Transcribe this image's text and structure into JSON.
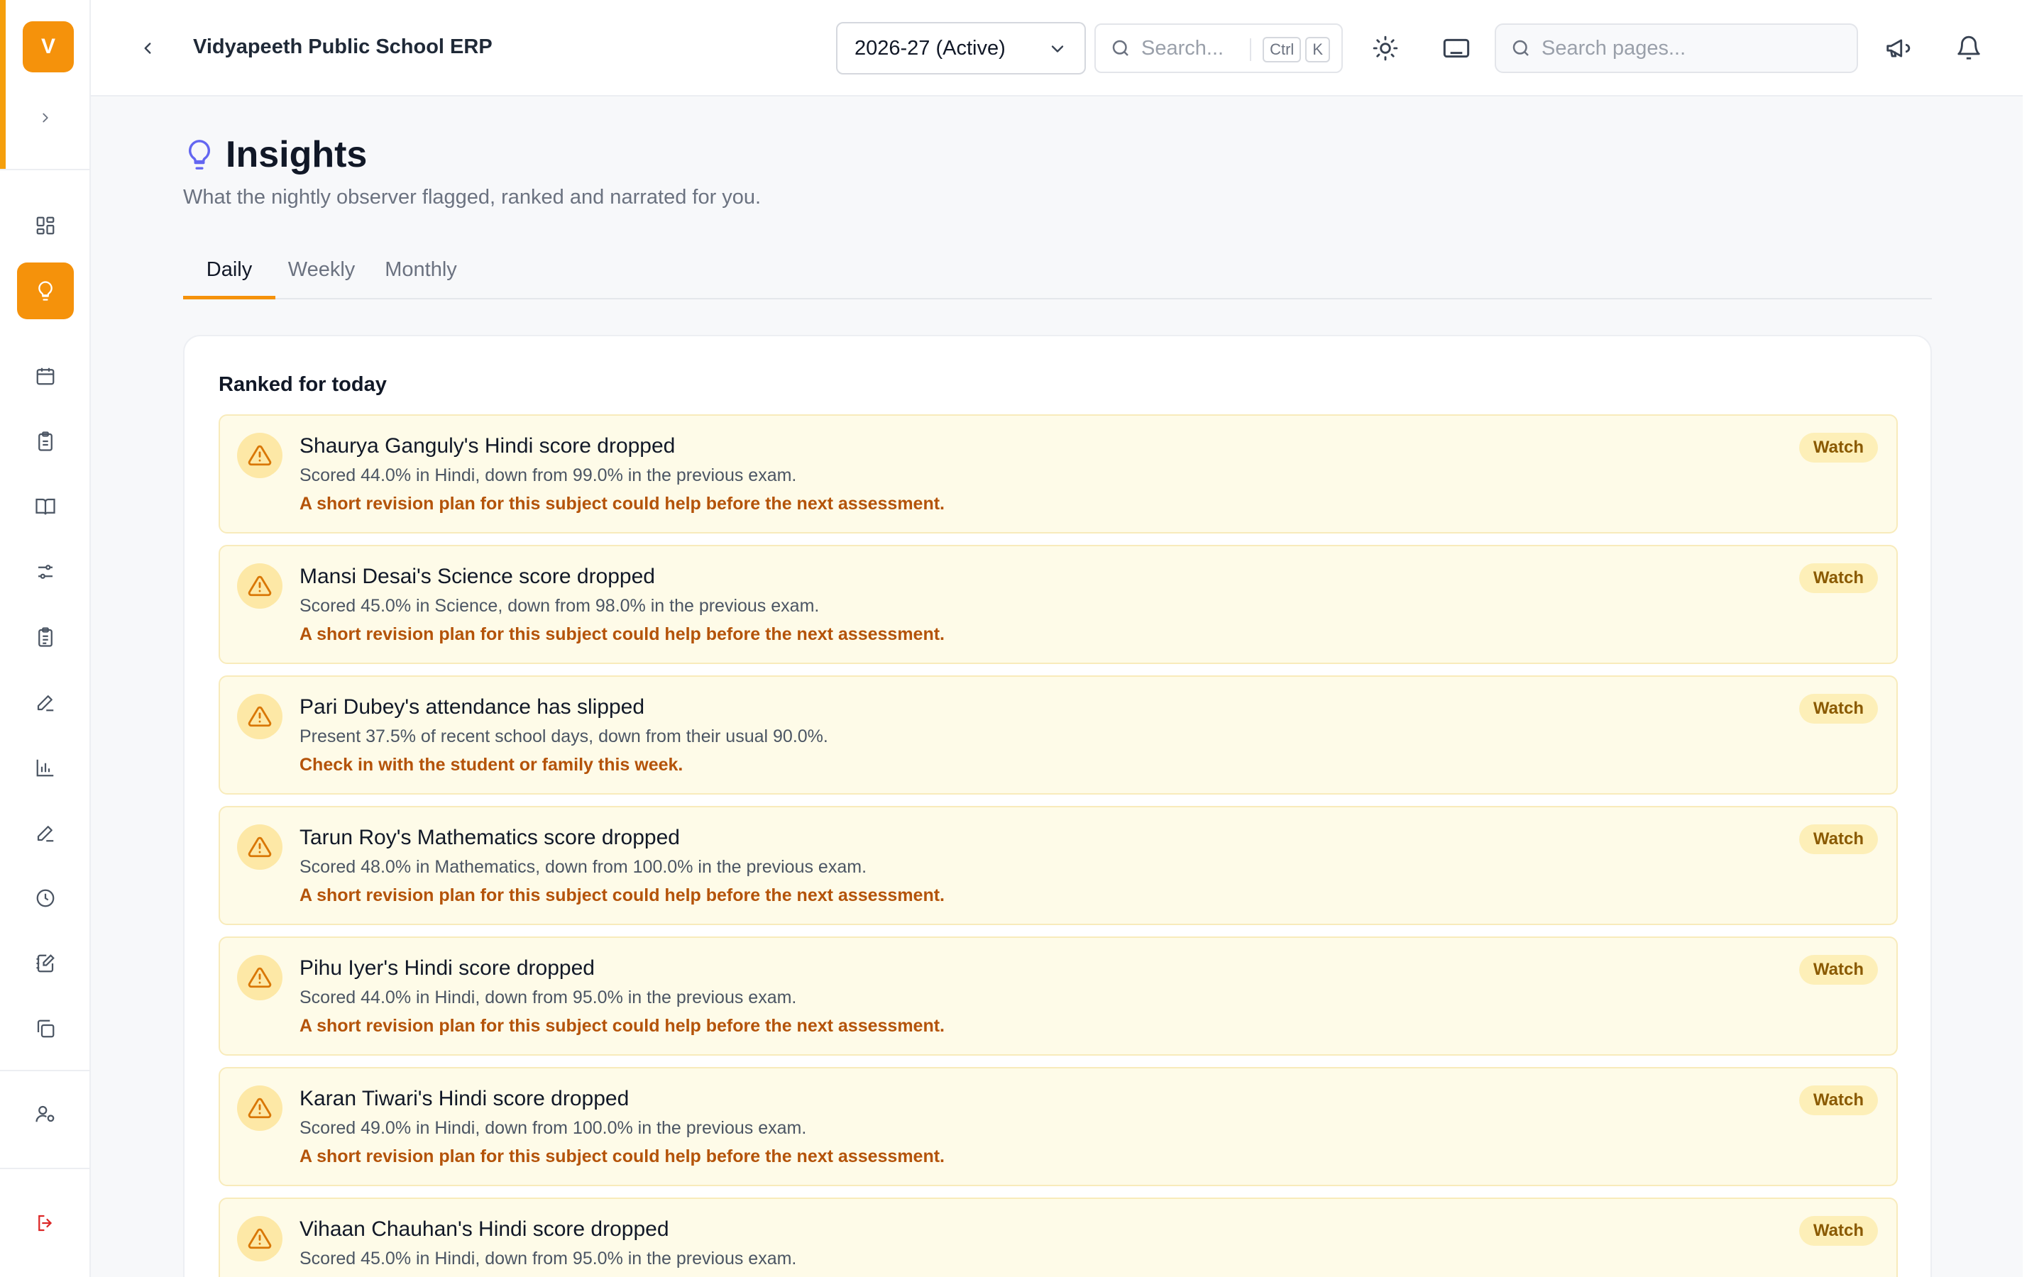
{
  "sidebar": {
    "logo_letter": "V",
    "items": [
      {
        "icon": "dashboard-icon"
      },
      {
        "icon": "lightbulb-icon",
        "active": true
      },
      {
        "icon": "calendar-icon"
      },
      {
        "icon": "clipboard-icon"
      },
      {
        "icon": "book-icon"
      },
      {
        "icon": "sliders-icon"
      },
      {
        "icon": "clipboard-list-icon"
      },
      {
        "icon": "pencil-icon"
      },
      {
        "icon": "bar-chart-icon"
      },
      {
        "icon": "edit-icon"
      },
      {
        "icon": "clock-icon"
      },
      {
        "icon": "notebook-pen-icon"
      },
      {
        "icon": "copy-icon"
      },
      {
        "icon": "user-settings-icon"
      },
      {
        "icon": "logout-icon"
      }
    ]
  },
  "header": {
    "title": "Vidyapeeth Public School ERP",
    "academic_year": "2026-27 (Active)",
    "search_placeholder": "Search...",
    "shortcut_keys": [
      "Ctrl",
      "K"
    ],
    "page_search_placeholder": "Search pages..."
  },
  "page": {
    "title": "Insights",
    "subtitle": "What the nightly observer flagged, ranked and narrated for you.",
    "tabs": [
      {
        "label": "Daily",
        "active": true
      },
      {
        "label": "Weekly",
        "active": false
      },
      {
        "label": "Monthly",
        "active": false
      }
    ]
  },
  "ranked": {
    "title": "Ranked for today",
    "items": [
      {
        "title": "Shaurya Ganguly's Hindi score dropped",
        "description": "Scored 44.0% in Hindi, down from 99.0% in the previous exam.",
        "tip": "A short revision plan for this subject could help before the next assessment.",
        "badge": "Watch"
      },
      {
        "title": "Mansi Desai's Science score dropped",
        "description": "Scored 45.0% in Science, down from 98.0% in the previous exam.",
        "tip": "A short revision plan for this subject could help before the next assessment.",
        "badge": "Watch"
      },
      {
        "title": "Pari Dubey's attendance has slipped",
        "description": "Present 37.5% of recent school days, down from their usual 90.0%.",
        "tip": "Check in with the student or family this week.",
        "badge": "Watch"
      },
      {
        "title": "Tarun Roy's Mathematics score dropped",
        "description": "Scored 48.0% in Mathematics, down from 100.0% in the previous exam.",
        "tip": "A short revision plan for this subject could help before the next assessment.",
        "badge": "Watch"
      },
      {
        "title": "Pihu Iyer's Hindi score dropped",
        "description": "Scored 44.0% in Hindi, down from 95.0% in the previous exam.",
        "tip": "A short revision plan for this subject could help before the next assessment.",
        "badge": "Watch"
      },
      {
        "title": "Karan Tiwari's Hindi score dropped",
        "description": "Scored 49.0% in Hindi, down from 100.0% in the previous exam.",
        "tip": "A short revision plan for this subject could help before the next assessment.",
        "badge": "Watch"
      },
      {
        "title": "Vihaan Chauhan's Hindi score dropped",
        "description": "Scored 45.0% in Hindi, down from 95.0% in the previous exam.",
        "tip": "",
        "badge": "Watch"
      }
    ]
  },
  "colors": {
    "accent": "#f5920b",
    "insight_bg": "#fefbe8",
    "insight_border": "#f8ebbb",
    "tip_text": "#b45309",
    "badge_bg": "#fdefb8"
  }
}
